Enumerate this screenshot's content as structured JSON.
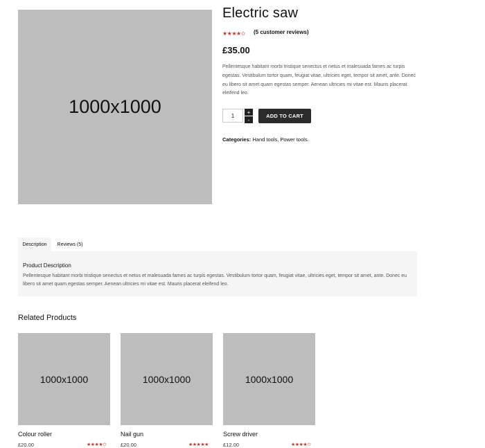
{
  "product": {
    "image_label": "1000x1000",
    "title": "Electric saw",
    "stars": "★★★★✩",
    "rating": 4,
    "rating_max": 5,
    "review_link": "(5 customer reviews)",
    "price": "£35.00",
    "description": "Pellentesque habitant morbi tristique senectus et netus et malesuada fames ac turpis egestas. Vestibulum tortor quam, feugiat vitae, ultricies eget, tempor sit amet, ante. Donec eu libero sit amet quam egestas semper. Aenean ultricies mi vitae est. Mauris placerat eleifend leo.",
    "quantity": "1",
    "qty_up": "+",
    "qty_down": "-",
    "add_to_cart": "ADD TO CART",
    "categories_label": "Categories:",
    "categories_value": "Hand tools, Power tools."
  },
  "tabs": [
    {
      "label": "Description"
    },
    {
      "label": "Reviews (5)"
    }
  ],
  "panel": {
    "title": "Product Description",
    "text": "Pellentesque habitant morbi tristique senectus et netus et malesuada fames ac turpis egestas. Vestibulum tortor quam, feugiat vitae, ultricies eget, tempor sit amet, ante. Donec eu libero sit amet quam egestas semper. Aenean ultricies mi vitae est. Mauris placerat eleifend leo."
  },
  "related": {
    "title": "Related Products",
    "items": [
      {
        "image_label": "1000x1000",
        "name": "Colour roller",
        "price": "£20.00",
        "stars": "★★★★✩",
        "rating": 4
      },
      {
        "image_label": "1000x1000",
        "name": "Nail gun",
        "price": "£20.00",
        "stars": "★★★★★",
        "rating": 5
      },
      {
        "image_label": "1000x1000",
        "name": "Screw driver",
        "price": "£12.00",
        "stars": "★★★★✩",
        "rating": 4
      }
    ]
  },
  "colors": {
    "accent_star": "#c0392b",
    "button_bg": "#2b2b2b",
    "placeholder_bg": "#bdbdbd",
    "panel_bg": "#f5f5f5"
  }
}
